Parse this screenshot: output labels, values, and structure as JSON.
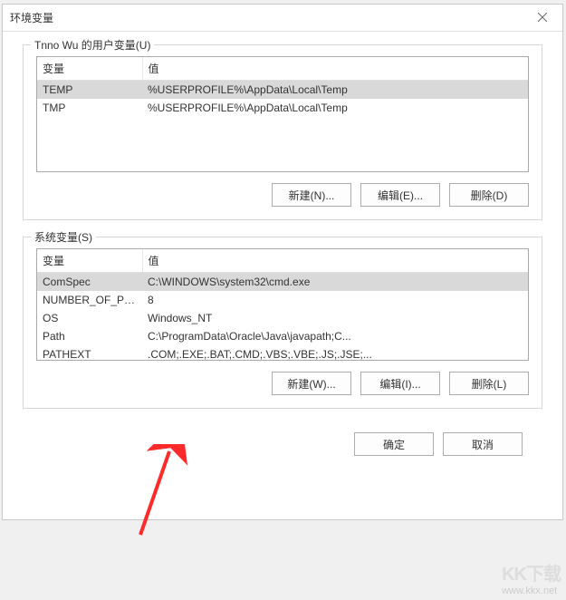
{
  "dialog": {
    "title": "环境变量"
  },
  "userVars": {
    "groupTitle": "Tnno Wu 的用户变量(U)",
    "columns": {
      "var": "变量",
      "val": "值"
    },
    "rows": [
      {
        "var": "TEMP",
        "val": "%USERPROFILE%\\AppData\\Local\\Temp",
        "selected": true
      },
      {
        "var": "TMP",
        "val": "%USERPROFILE%\\AppData\\Local\\Temp",
        "selected": false
      }
    ],
    "buttons": {
      "new": "新建(N)...",
      "edit": "编辑(E)...",
      "del": "删除(D)"
    }
  },
  "sysVars": {
    "groupTitle": "系统变量(S)",
    "columns": {
      "var": "变量",
      "val": "值"
    },
    "rows": [
      {
        "var": "ComSpec",
        "val": "C:\\WINDOWS\\system32\\cmd.exe",
        "selected": true
      },
      {
        "var": "NUMBER_OF_PR...",
        "val": "8",
        "selected": false
      },
      {
        "var": "OS",
        "val": "Windows_NT",
        "selected": false
      },
      {
        "var": "Path",
        "val": "C:\\ProgramData\\Oracle\\Java\\javapath;C...",
        "selected": false
      },
      {
        "var": "PATHEXT",
        "val": ".COM;.EXE;.BAT;.CMD;.VBS;.VBE;.JS;.JSE;...",
        "selected": false
      }
    ],
    "buttons": {
      "new": "新建(W)...",
      "edit": "编辑(I)...",
      "del": "删除(L)"
    }
  },
  "footer": {
    "ok": "确定",
    "cancel": "取消"
  },
  "watermark": {
    "brand": "KK下载",
    "url": "www.kkx.net"
  }
}
